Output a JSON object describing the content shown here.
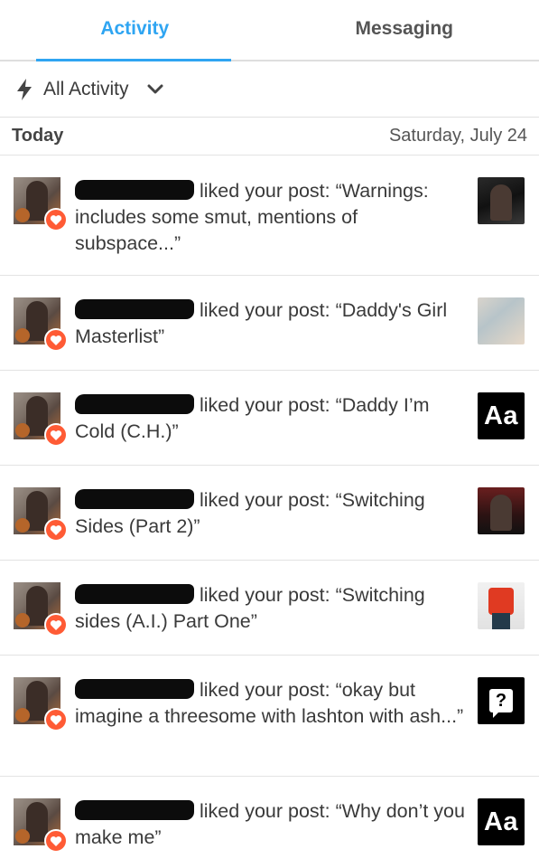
{
  "tabs": [
    {
      "label": "Activity",
      "active": true
    },
    {
      "label": "Messaging",
      "active": false
    }
  ],
  "filter": {
    "icon": "lightning-bolt-icon",
    "label": "All Activity",
    "dropdown_icon": "chevron-down-icon"
  },
  "section": {
    "title": "Today",
    "date": "Saturday, July 24"
  },
  "colors": {
    "accent": "#2fa5f2",
    "heart": "#ff5b35",
    "text": "#3a3a3a"
  },
  "items": [
    {
      "action": "liked your post: “Warnings: includes some smut, mentions of subspace...”",
      "thumb": "photo-thumbnail"
    },
    {
      "action": "liked your post: “Daddy's Girl Masterlist”",
      "thumb": "photo-thumbnail"
    },
    {
      "action": "liked your post: “Daddy I’m Cold (C.H.)”",
      "thumb": "text-post-thumbnail",
      "thumb_text": "Aa"
    },
    {
      "action": "liked your post: “Switching Sides (Part 2)”",
      "thumb": "photo-thumbnail"
    },
    {
      "action": "liked your post: “Switching sides (A.I.) Part One”",
      "thumb": "photo-thumbnail"
    },
    {
      "action": "liked your post: “okay but imagine a threesome with lashton with ash...”",
      "thumb": "ask-post-thumbnail",
      "thumb_text": "?"
    },
    {
      "action": "liked your post: “Why don’t you make me”",
      "thumb": "text-post-thumbnail",
      "thumb_text": "Aa"
    }
  ]
}
